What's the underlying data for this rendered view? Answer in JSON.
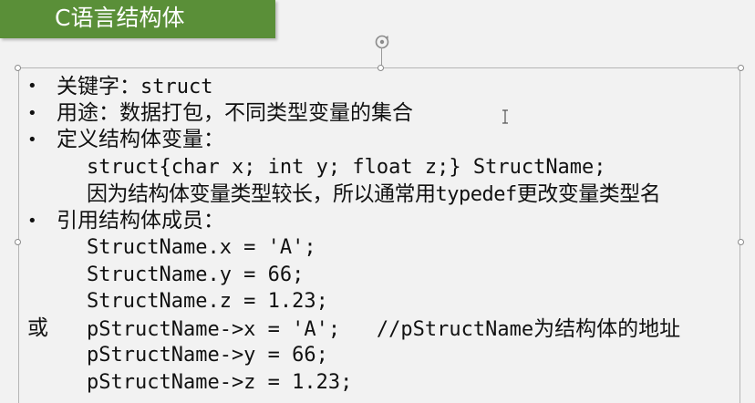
{
  "title": "C语言结构体",
  "bullets": {
    "keyword_label": "关键字：",
    "keyword_code": "struct",
    "purpose": "用途：数据打包，不同类型变量的集合",
    "define_label": "定义结构体变量：",
    "define_code": "struct{char x; int y; float z;} StructName;",
    "define_note_a": "因为结构体变量类型较长，所以通常用",
    "define_note_b": "typedef",
    "define_note_c": "更改变量类型名",
    "ref_label": "引用结构体成员：",
    "ref_line1": "StructName.x = 'A';",
    "ref_line2": "StructName.y = 66;",
    "ref_line3": "StructName.z = 1.23;",
    "or_label": "或",
    "ptr_line1": "pStructName->x = 'A';",
    "ptr_comment_a": "//pStructName",
    "ptr_comment_b": "为结构体的地址",
    "ptr_line2": "pStructName->y = 66;",
    "ptr_line3": "pStructName->z = 1.23;"
  },
  "colors": {
    "title_bar": "#5a8f38",
    "title_text": "#ffffff",
    "body_text": "#111111",
    "background": "#f2f2f2"
  },
  "icons": {
    "rotate": "rotate-handle-icon",
    "cursor": "i-beam-cursor-icon",
    "bullet": "•"
  }
}
